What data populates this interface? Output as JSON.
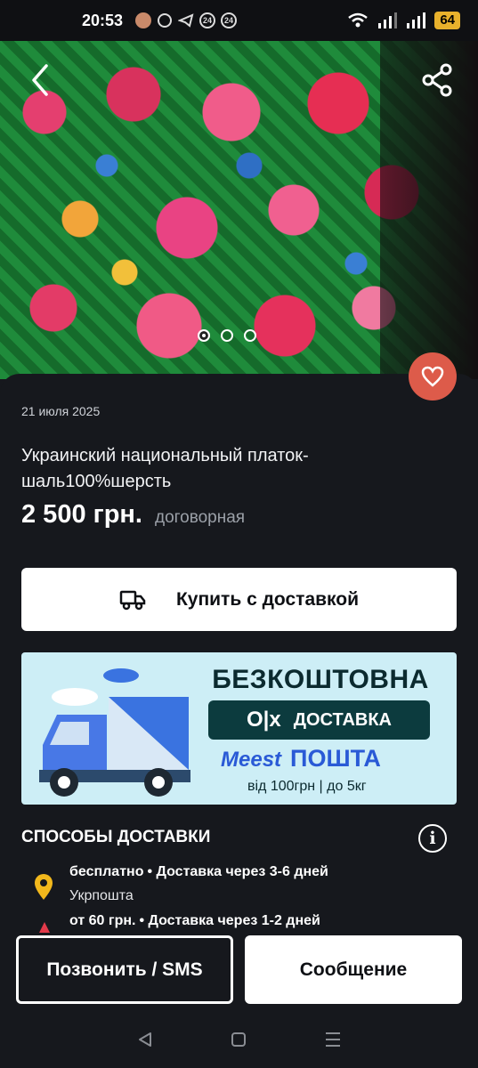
{
  "status_bar": {
    "time": "20:53",
    "notif_24a": "24",
    "notif_24b": "24",
    "battery": "64"
  },
  "listing": {
    "date": "21 июля 2025",
    "title": "Украинский национальный платок-шаль100%шерсть",
    "price": "2 500 грн.",
    "negotiable": "договорная"
  },
  "buy_button": {
    "label": "Купить с доставкой"
  },
  "banner": {
    "title": "БЕЗКОШТОВНА",
    "olx_logo": "O|x",
    "olx_text": "ДОСТАВКА",
    "meest_logo": "Meest",
    "post_text": "ПОШТА",
    "terms": "від 100грн | до 5кг"
  },
  "delivery": {
    "header": "СПОСОБЫ ДОСТАВКИ",
    "options": [
      {
        "price": "бесплатно",
        "time": "• Доставка через 3-6 дней",
        "carrier": "Укрпошта"
      },
      {
        "price": "от 60 грн.",
        "time": "• Доставка через 1-2 дней"
      }
    ]
  },
  "actions": {
    "call_label": "Позвонить / SMS",
    "message_label": "Сообщение"
  },
  "image_carousel": {
    "current": 1,
    "total": 3
  },
  "colors": {
    "background": "#16181d",
    "favorite": "#dd5b4a",
    "banner_bg": "#cdeef6",
    "olx_dark": "#0c3b3e",
    "meest_blue": "#2a5ad6"
  }
}
